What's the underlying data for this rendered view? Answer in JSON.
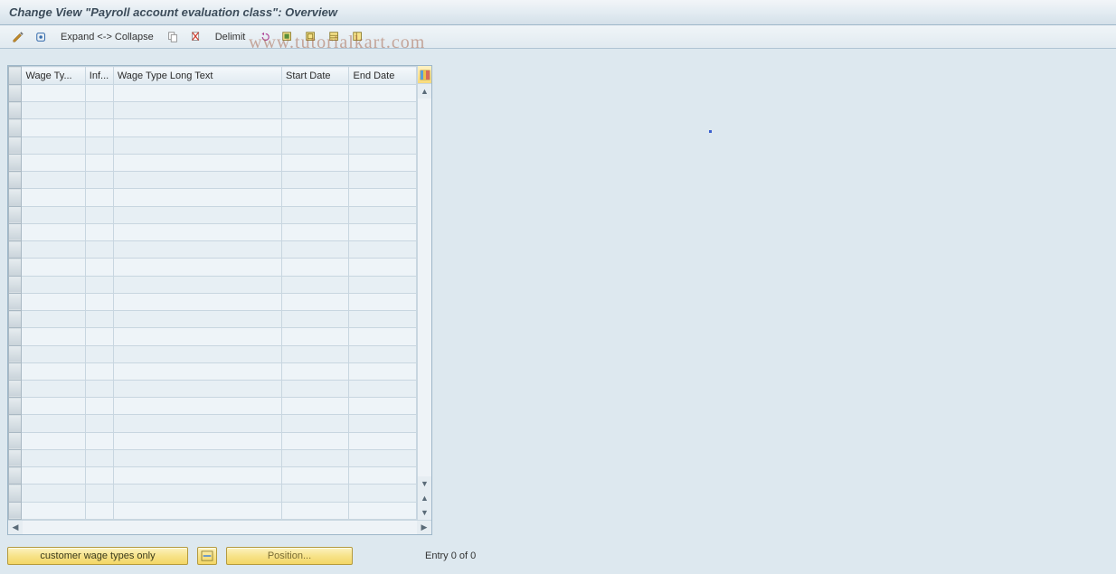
{
  "title": "Change View \"Payroll account evaluation class\": Overview",
  "toolbar": {
    "expand_collapse_label": "Expand <-> Collapse",
    "delimit_label": "Delimit"
  },
  "table": {
    "columns": {
      "wage_type": "Wage Ty...",
      "inf": "Inf...",
      "long_text": "Wage Type Long Text",
      "start_date": "Start Date",
      "end_date": "End Date"
    },
    "row_count": 25
  },
  "footer": {
    "filter_button": "customer wage types only",
    "position_button": "Position...",
    "entry_text": "Entry 0 of 0"
  },
  "watermark": "www.tutorialkart.com"
}
